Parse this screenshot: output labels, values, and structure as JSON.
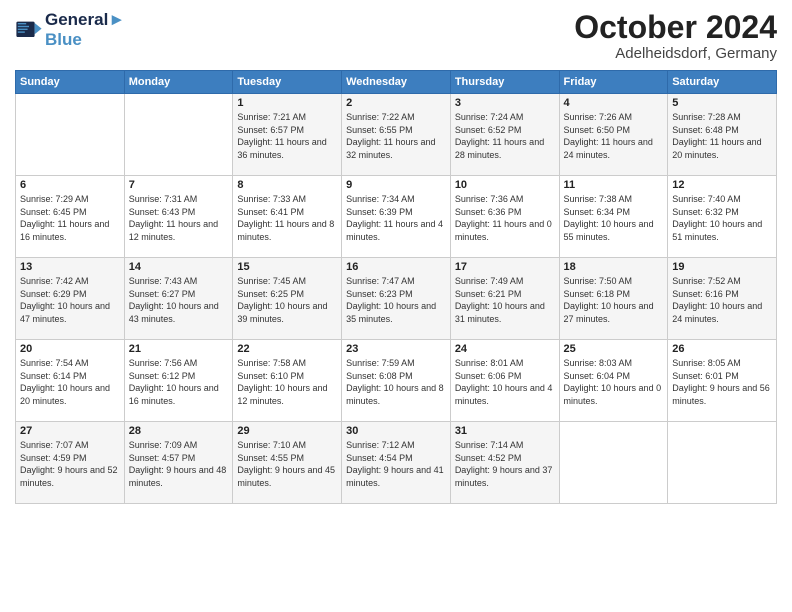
{
  "logo": {
    "line1": "General",
    "line2": "Blue"
  },
  "title": "October 2024",
  "location": "Adelheidsdorf, Germany",
  "days_header": [
    "Sunday",
    "Monday",
    "Tuesday",
    "Wednesday",
    "Thursday",
    "Friday",
    "Saturday"
  ],
  "weeks": [
    [
      {
        "day": "",
        "content": ""
      },
      {
        "day": "",
        "content": ""
      },
      {
        "day": "1",
        "content": "Sunrise: 7:21 AM\nSunset: 6:57 PM\nDaylight: 11 hours and 36 minutes."
      },
      {
        "day": "2",
        "content": "Sunrise: 7:22 AM\nSunset: 6:55 PM\nDaylight: 11 hours and 32 minutes."
      },
      {
        "day": "3",
        "content": "Sunrise: 7:24 AM\nSunset: 6:52 PM\nDaylight: 11 hours and 28 minutes."
      },
      {
        "day": "4",
        "content": "Sunrise: 7:26 AM\nSunset: 6:50 PM\nDaylight: 11 hours and 24 minutes."
      },
      {
        "day": "5",
        "content": "Sunrise: 7:28 AM\nSunset: 6:48 PM\nDaylight: 11 hours and 20 minutes."
      }
    ],
    [
      {
        "day": "6",
        "content": "Sunrise: 7:29 AM\nSunset: 6:45 PM\nDaylight: 11 hours and 16 minutes."
      },
      {
        "day": "7",
        "content": "Sunrise: 7:31 AM\nSunset: 6:43 PM\nDaylight: 11 hours and 12 minutes."
      },
      {
        "day": "8",
        "content": "Sunrise: 7:33 AM\nSunset: 6:41 PM\nDaylight: 11 hours and 8 minutes."
      },
      {
        "day": "9",
        "content": "Sunrise: 7:34 AM\nSunset: 6:39 PM\nDaylight: 11 hours and 4 minutes."
      },
      {
        "day": "10",
        "content": "Sunrise: 7:36 AM\nSunset: 6:36 PM\nDaylight: 11 hours and 0 minutes."
      },
      {
        "day": "11",
        "content": "Sunrise: 7:38 AM\nSunset: 6:34 PM\nDaylight: 10 hours and 55 minutes."
      },
      {
        "day": "12",
        "content": "Sunrise: 7:40 AM\nSunset: 6:32 PM\nDaylight: 10 hours and 51 minutes."
      }
    ],
    [
      {
        "day": "13",
        "content": "Sunrise: 7:42 AM\nSunset: 6:29 PM\nDaylight: 10 hours and 47 minutes."
      },
      {
        "day": "14",
        "content": "Sunrise: 7:43 AM\nSunset: 6:27 PM\nDaylight: 10 hours and 43 minutes."
      },
      {
        "day": "15",
        "content": "Sunrise: 7:45 AM\nSunset: 6:25 PM\nDaylight: 10 hours and 39 minutes."
      },
      {
        "day": "16",
        "content": "Sunrise: 7:47 AM\nSunset: 6:23 PM\nDaylight: 10 hours and 35 minutes."
      },
      {
        "day": "17",
        "content": "Sunrise: 7:49 AM\nSunset: 6:21 PM\nDaylight: 10 hours and 31 minutes."
      },
      {
        "day": "18",
        "content": "Sunrise: 7:50 AM\nSunset: 6:18 PM\nDaylight: 10 hours and 27 minutes."
      },
      {
        "day": "19",
        "content": "Sunrise: 7:52 AM\nSunset: 6:16 PM\nDaylight: 10 hours and 24 minutes."
      }
    ],
    [
      {
        "day": "20",
        "content": "Sunrise: 7:54 AM\nSunset: 6:14 PM\nDaylight: 10 hours and 20 minutes."
      },
      {
        "day": "21",
        "content": "Sunrise: 7:56 AM\nSunset: 6:12 PM\nDaylight: 10 hours and 16 minutes."
      },
      {
        "day": "22",
        "content": "Sunrise: 7:58 AM\nSunset: 6:10 PM\nDaylight: 10 hours and 12 minutes."
      },
      {
        "day": "23",
        "content": "Sunrise: 7:59 AM\nSunset: 6:08 PM\nDaylight: 10 hours and 8 minutes."
      },
      {
        "day": "24",
        "content": "Sunrise: 8:01 AM\nSunset: 6:06 PM\nDaylight: 10 hours and 4 minutes."
      },
      {
        "day": "25",
        "content": "Sunrise: 8:03 AM\nSunset: 6:04 PM\nDaylight: 10 hours and 0 minutes."
      },
      {
        "day": "26",
        "content": "Sunrise: 8:05 AM\nSunset: 6:01 PM\nDaylight: 9 hours and 56 minutes."
      }
    ],
    [
      {
        "day": "27",
        "content": "Sunrise: 7:07 AM\nSunset: 4:59 PM\nDaylight: 9 hours and 52 minutes."
      },
      {
        "day": "28",
        "content": "Sunrise: 7:09 AM\nSunset: 4:57 PM\nDaylight: 9 hours and 48 minutes."
      },
      {
        "day": "29",
        "content": "Sunrise: 7:10 AM\nSunset: 4:55 PM\nDaylight: 9 hours and 45 minutes."
      },
      {
        "day": "30",
        "content": "Sunrise: 7:12 AM\nSunset: 4:54 PM\nDaylight: 9 hours and 41 minutes."
      },
      {
        "day": "31",
        "content": "Sunrise: 7:14 AM\nSunset: 4:52 PM\nDaylight: 9 hours and 37 minutes."
      },
      {
        "day": "",
        "content": ""
      },
      {
        "day": "",
        "content": ""
      }
    ]
  ]
}
